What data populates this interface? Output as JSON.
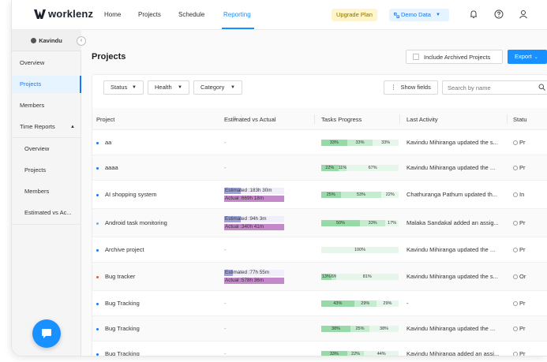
{
  "topnav": {
    "logo_text": "worklenz",
    "items": [
      {
        "label": "Home"
      },
      {
        "label": "Projects"
      },
      {
        "label": "Schedule"
      },
      {
        "label": "Reporting"
      }
    ],
    "upgrade_label": "Upgrade Plan",
    "demo_label": "Demo Data",
    "accent": "#1890ff"
  },
  "sidebar": {
    "team_name": "Kavindu",
    "items": [
      {
        "label": "Overview"
      },
      {
        "label": "Projects"
      },
      {
        "label": "Members"
      },
      {
        "label": "Time Reports"
      }
    ],
    "sub_items": [
      {
        "label": "Overview"
      },
      {
        "label": "Projects"
      },
      {
        "label": "Members"
      },
      {
        "label": "Estimated vs Ac..."
      }
    ]
  },
  "main": {
    "title": "Projects",
    "archived_label": "Include Archived Projects",
    "export_label": "Export",
    "filters": [
      {
        "label": "Status"
      },
      {
        "label": "Health"
      },
      {
        "label": "Category"
      }
    ],
    "show_fields_label": "Show fields",
    "search_placeholder": "Search by name"
  },
  "table": {
    "columns": [
      {
        "label": "Project"
      },
      {
        "label": "Estimated vs Actual"
      },
      {
        "label": "Tasks Progress"
      },
      {
        "label": "Last Activity"
      },
      {
        "label": "Statu"
      }
    ],
    "rows": [
      {
        "name": "aa",
        "dot": "#1677ff",
        "est": null,
        "act": null,
        "progress": [
          {
            "label": "33%",
            "pct": 33
          },
          {
            "label": "33%",
            "pct": 33
          },
          {
            "label": "33%",
            "pct": 33
          }
        ],
        "activity": "Kavindu Mihiranga updated the s...",
        "status": "Pr"
      },
      {
        "name": "aaaa",
        "dot": "#1677ff",
        "est": null,
        "act": null,
        "progress": [
          {
            "label": "22%",
            "pct": 22
          },
          {
            "label": "11%",
            "pct": 11
          },
          {
            "label": "67%",
            "pct": 67
          }
        ],
        "activity": "Kavindu Mihiranga updated the ...",
        "status": "Pr"
      },
      {
        "name": "AI shopping system",
        "dot": "#1677ff",
        "est": "Estimated :183h 30m",
        "est_ratio": 0.27,
        "act": "Actual :669h 18m",
        "progress": [
          {
            "label": "25%",
            "pct": 25
          },
          {
            "label": "53%",
            "pct": 53
          },
          {
            "label": "22%",
            "pct": 22
          }
        ],
        "activity": "Chathuranga Pathum updated th...",
        "status": "In"
      },
      {
        "name": "Android task monitoring",
        "dot": "#7ba7e8",
        "est": "Estimated :94h 3m",
        "est_ratio": 0.28,
        "act": "Actual :340h 41m",
        "progress": [
          {
            "label": "50%",
            "pct": 50
          },
          {
            "label": "33%",
            "pct": 33
          },
          {
            "label": "17%",
            "pct": 17
          }
        ],
        "activity": "Malaka Sandakal added an assig...",
        "status": "Pr"
      },
      {
        "name": "Archive project",
        "dot": "#1677ff",
        "est": null,
        "act": null,
        "progress": [
          {
            "label": "100%",
            "pct": 100
          }
        ],
        "activity": "Kavindu Mihiranga updated the ...",
        "status": "Pr"
      },
      {
        "name": "Bug tracker",
        "dot": "#e8574a",
        "est": "Estimated :77h 55m",
        "est_ratio": 0.14,
        "act": "Actual :578h 36m",
        "progress": [
          {
            "label": "13%",
            "pct": 13
          },
          {
            "label": "6%",
            "pct": 6
          },
          {
            "label": "81%",
            "pct": 81
          }
        ],
        "activity": "Kavindu Mihiranga updated the s...",
        "status": "Or"
      },
      {
        "name": "Bug Tracking",
        "dot": "#1677ff",
        "est": null,
        "act": null,
        "progress": [
          {
            "label": "43%",
            "pct": 43
          },
          {
            "label": "29%",
            "pct": 29
          },
          {
            "label": "29%",
            "pct": 29
          }
        ],
        "activity": "-",
        "status": "Pr"
      },
      {
        "name": "Bug Tracking",
        "dot": "#1677ff",
        "est": null,
        "act": null,
        "progress": [
          {
            "label": "38%",
            "pct": 38
          },
          {
            "label": "25%",
            "pct": 25
          },
          {
            "label": "38%",
            "pct": 38
          }
        ],
        "activity": "Kavindu Mihiranga updated the ...",
        "status": "Pr"
      },
      {
        "name": "Bug Tracking",
        "dot": "#1677ff",
        "est": null,
        "act": null,
        "progress": [
          {
            "label": "33%",
            "pct": 33
          },
          {
            "label": "22%",
            "pct": 22
          },
          {
            "label": "44%",
            "pct": 44
          }
        ],
        "activity": "Kavindu Mihiranga added an assi...",
        "status": "Pr"
      }
    ]
  }
}
